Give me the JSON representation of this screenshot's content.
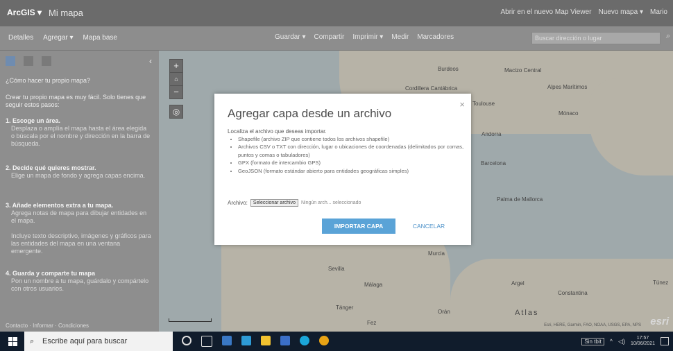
{
  "header": {
    "brand": "ArcGIS ▾",
    "map_name": "Mi mapa",
    "right_items": [
      "Abrir en el nuevo Map Viewer",
      "Nuevo mapa ▾",
      "Mario"
    ]
  },
  "toolbar": {
    "left": [
      "Detalles",
      "Agregar ▾",
      "Mapa base"
    ],
    "right": [
      "Guardar ▾",
      "Compartir",
      "Imprimir ▾",
      "Medir",
      "Marcadores"
    ],
    "search_placeholder": "Buscar dirección o lugar"
  },
  "left_panel": {
    "question": "¿Cómo hacer tu propio mapa?",
    "intro": "Crear tu propio mapa es muy fácil. Solo tienes que seguir estos pasos:",
    "steps": [
      {
        "title": "1. Escoge un área.",
        "text": "Desplaza o amplía el mapa hasta el área elegida o búscala por el nombre y dirección en la barra de búsqueda."
      },
      {
        "title": "2. Decide qué quieres mostrar.",
        "text": "Elige un mapa de fondo y agrega capas encima."
      },
      {
        "title": "3. Añade elementos extra a tu mapa.",
        "text": "Agrega notas de mapa para dibujar entidades en el mapa."
      },
      {
        "title": "",
        "text": "Incluye texto descriptivo, imágenes y gráficos para las entidades del mapa en una ventana emergente."
      },
      {
        "title": "4. Guarda y comparte tu mapa",
        "text": "Pon un nombre a tu mapa, guárdalo y compártelo con otros usuarios."
      }
    ],
    "footer": "Contacto · Informar · Condiciones"
  },
  "map": {
    "places": [
      {
        "name": "Burdeos"
      },
      {
        "name": "Macizo Central"
      },
      {
        "name": "Alpes Marítimos"
      },
      {
        "name": "Mónaco"
      },
      {
        "name": "Cordillera Cantábrica"
      },
      {
        "name": "Toulouse"
      },
      {
        "name": "Andorra"
      },
      {
        "name": "Barcelona"
      },
      {
        "name": "Palma de Mallorca"
      },
      {
        "name": "Sevilla"
      },
      {
        "name": "Málaga"
      },
      {
        "name": "Murcia"
      },
      {
        "name": "Argel"
      },
      {
        "name": "Constantina"
      },
      {
        "name": "Túnez"
      },
      {
        "name": "Tánger"
      },
      {
        "name": "Atlas"
      },
      {
        "name": "Orán"
      },
      {
        "name": "Fez"
      }
    ],
    "esri": "esri",
    "attribution": "Esri, HERE, Garmin, FAO, NOAA, USGS, EPA, NPS"
  },
  "dialog": {
    "title": "Agregar capa desde un archivo",
    "intro": "Localiza el archivo que deseas importar.",
    "items": [
      "Shapefile (archivo ZIP que contiene todos los archivos shapefile)",
      "Archivos CSV o TXT con dirección, lugar o ubicaciones de coordenadas (delimitados por comas, puntos y comas o tabuladores)",
      "GPX (formato de intercambio GPS)",
      "GeoJSON (formato estándar abierto para entidades geográficas simples)"
    ],
    "file_label": "Archivo:",
    "file_button": "Seleccionar archivo",
    "file_status": "Ningún arch... seleccionado",
    "import_button": "IMPORTAR CAPA",
    "cancel_button": "CANCELAR"
  },
  "taskbar": {
    "search_placeholder": "Escribe aquí para buscar",
    "tray_badge": "Sin tbit",
    "time": "17:57",
    "date": "10/06/2021"
  }
}
